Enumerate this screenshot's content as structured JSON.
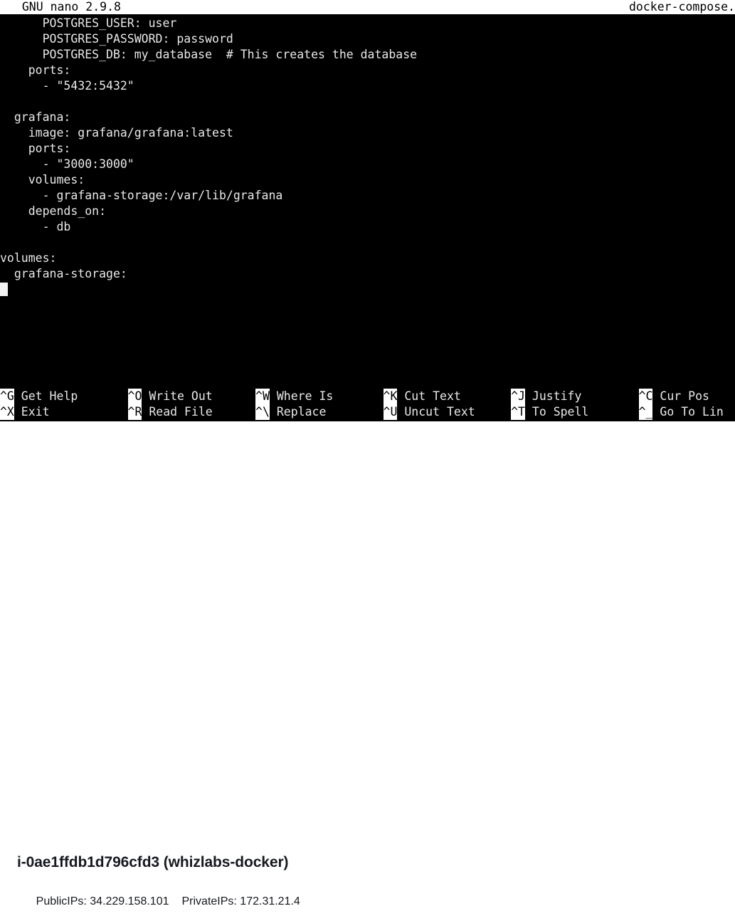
{
  "terminal": {
    "titlebar": {
      "left": "  GNU nano 2.9.8",
      "filename": "docker-compose."
    },
    "lines": [
      "      POSTGRES_USER: user",
      "      POSTGRES_PASSWORD: password",
      "      POSTGRES_DB: my_database  # This creates the database",
      "    ports:",
      "      - \"5432:5432\"",
      "",
      "  grafana:",
      "    image: grafana/grafana:latest",
      "    ports:",
      "      - \"3000:3000\"",
      "    volumes:",
      "      - grafana-storage:/var/lib/grafana",
      "    depends_on:",
      "      - db",
      "",
      "volumes:",
      "  grafana-storage:"
    ],
    "cursor": {
      "line": 17,
      "column": 0
    },
    "shortcuts": [
      {
        "key": "^G",
        "label": " Get Help",
        "col": 0,
        "row": 0
      },
      {
        "key": "^X",
        "label": " Exit",
        "col": 0,
        "row": 1
      },
      {
        "key": "^O",
        "label": " Write Out",
        "col": 16,
        "row": 0
      },
      {
        "key": "^R",
        "label": " Read File",
        "col": 16,
        "row": 1
      },
      {
        "key": "^W",
        "label": " Where Is",
        "col": 32,
        "row": 0
      },
      {
        "key": "^\\",
        "label": " Replace",
        "col": 32,
        "row": 1
      },
      {
        "key": "^K",
        "label": " Cut Text",
        "col": 48,
        "row": 0
      },
      {
        "key": "^U",
        "label": " Uncut Text",
        "col": 48,
        "row": 1
      },
      {
        "key": "^J",
        "label": " Justify",
        "col": 64,
        "row": 0
      },
      {
        "key": "^T",
        "label": " To Spell",
        "col": 64,
        "row": 1
      },
      {
        "key": "^C",
        "label": " Cur Pos",
        "col": 80,
        "row": 0
      },
      {
        "key": "^_",
        "label": " Go To Lin",
        "col": 80,
        "row": 1
      }
    ]
  },
  "status": {
    "instance_title": "i-0ae1ffdb1d796cfd3 (whizlabs-docker)",
    "public_ips_label": "PublicIPs:",
    "public_ips_value": "34.229.158.101",
    "private_ips_label": "PrivateIPs:",
    "private_ips_value": "172.31.21.4"
  },
  "colors": {
    "terminal_bg": "#000000",
    "terminal_fg": "#e9e9e9",
    "titlebar_bg": "#ffffff",
    "titlebar_fg": "#000000",
    "status_fg": "#16191f",
    "page_bg": "#ffffff"
  }
}
